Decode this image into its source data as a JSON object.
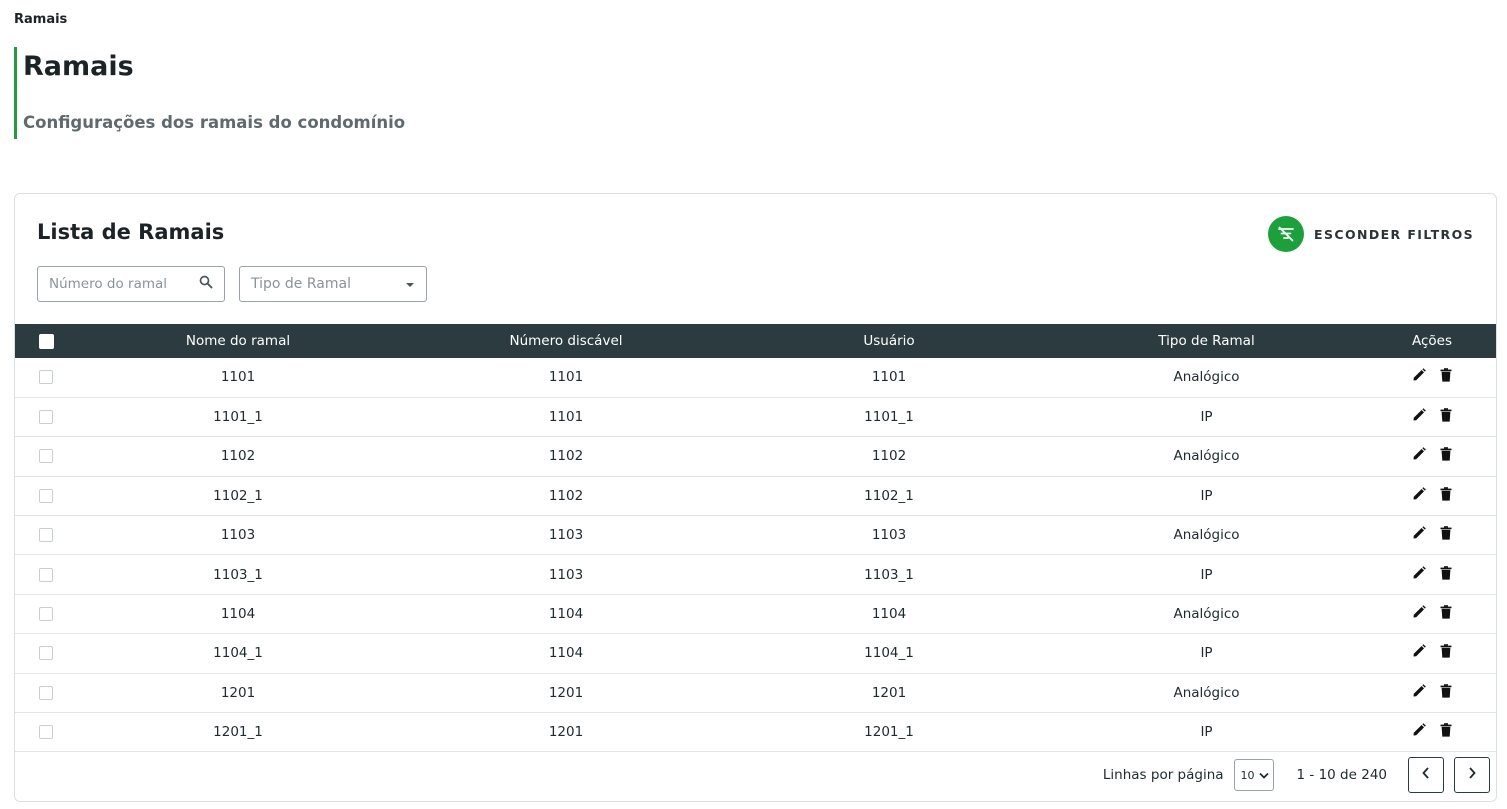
{
  "breadcrumb": "Ramais",
  "page": {
    "title": "Ramais",
    "subtitle": "Configurações dos ramais do condomínio"
  },
  "card": {
    "title": "Lista de Ramais",
    "hide_filters_label": "ESCONDER FILTROS"
  },
  "filters": {
    "search_placeholder": "Número do ramal",
    "type_placeholder": "Tipo de Ramal"
  },
  "table": {
    "headers": {
      "name": "Nome do ramal",
      "number": "Número discável",
      "user": "Usuário",
      "type": "Tipo de Ramal",
      "actions": "Ações"
    },
    "rows": [
      {
        "name": "1101",
        "number": "1101",
        "user": "1101",
        "type": "Analógico"
      },
      {
        "name": "1101_1",
        "number": "1101",
        "user": "1101_1",
        "type": "IP"
      },
      {
        "name": "1102",
        "number": "1102",
        "user": "1102",
        "type": "Analógico"
      },
      {
        "name": "1102_1",
        "number": "1102",
        "user": "1102_1",
        "type": "IP"
      },
      {
        "name": "1103",
        "number": "1103",
        "user": "1103",
        "type": "Analógico"
      },
      {
        "name": "1103_1",
        "number": "1103",
        "user": "1103_1",
        "type": "IP"
      },
      {
        "name": "1104",
        "number": "1104",
        "user": "1104",
        "type": "Analógico"
      },
      {
        "name": "1104_1",
        "number": "1104",
        "user": "1104_1",
        "type": "IP"
      },
      {
        "name": "1201",
        "number": "1201",
        "user": "1201",
        "type": "Analógico"
      },
      {
        "name": "1201_1",
        "number": "1201",
        "user": "1201_1",
        "type": "IP"
      }
    ]
  },
  "pagination": {
    "rows_per_page_label": "Linhas por página",
    "rows_per_page_value": "10",
    "range": "1 - 10 de 240"
  },
  "colors": {
    "accent": "#1aa13c",
    "header_bg": "#2c3b3f"
  },
  "icons": {
    "search": "search-icon",
    "dropdown": "caret-down-icon",
    "filter_off": "filter-off-icon",
    "edit": "pencil-icon",
    "delete": "trash-icon",
    "prev": "chevron-left-icon",
    "next": "chevron-right-icon"
  }
}
